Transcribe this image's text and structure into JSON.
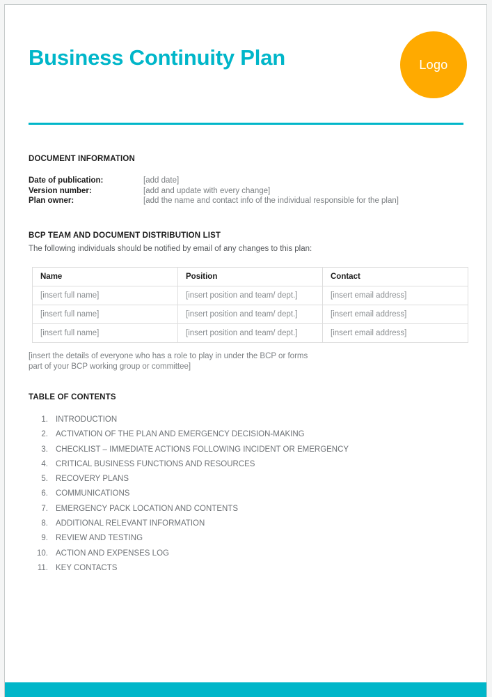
{
  "document": {
    "title": "Business Continuity Plan",
    "logo_label": "Logo",
    "accent_color": "#00b6c9",
    "logo_color": "#ffaa00"
  },
  "document_information": {
    "heading": "DOCUMENT INFORMATION",
    "fields": [
      {
        "label": "Date of publication:",
        "value": "[add date]"
      },
      {
        "label": "Version number:",
        "value": "[add and update with every change]"
      },
      {
        "label": "Plan owner:",
        "value": "[add the name and contact info of the individual responsible for the plan]"
      }
    ]
  },
  "bcp_team": {
    "heading": "BCP TEAM AND DOCUMENT DISTRIBUTION LIST",
    "intro": "The following individuals should be notified by email of any changes to this plan:",
    "columns": [
      "Name",
      "Position",
      "Contact"
    ],
    "rows": [
      [
        "[insert full name]",
        "[insert position and team/ dept.]",
        "[insert email address]"
      ],
      [
        "[insert full name]",
        "[insert position and team/ dept.]",
        "[insert email address]"
      ],
      [
        "[insert full name]",
        "[insert position and team/ dept.]",
        "[insert email address]"
      ]
    ],
    "note": "[insert the details of everyone who has a role to play in under the BCP or forms part of your BCP working group or committee]"
  },
  "table_of_contents": {
    "heading": "TABLE OF CONTENTS",
    "items": [
      {
        "number": "1.",
        "label": "INTRODUCTION"
      },
      {
        "number": "2.",
        "label": "ACTIVATION OF THE PLAN AND EMERGENCY DECISION-MAKING"
      },
      {
        "number": "3.",
        "label": "CHECKLIST – IMMEDIATE ACTIONS FOLLOWING INCIDENT OR EMERGENCY"
      },
      {
        "number": "4.",
        "label": "CRITICAL BUSINESS FUNCTIONS AND RESOURCES"
      },
      {
        "number": "5.",
        "label": "RECOVERY PLANS"
      },
      {
        "number": "6.",
        "label": "COMMUNICATIONS"
      },
      {
        "number": "7.",
        "label": "EMERGENCY PACK LOCATION AND CONTENTS"
      },
      {
        "number": "8.",
        "label": "ADDITIONAL RELEVANT INFORMATION"
      },
      {
        "number": "9.",
        "label": "REVIEW AND TESTING"
      },
      {
        "number": "10.",
        "label": "ACTION AND EXPENSES LOG"
      },
      {
        "number": "11.",
        "label": "KEY CONTACTS"
      }
    ]
  }
}
